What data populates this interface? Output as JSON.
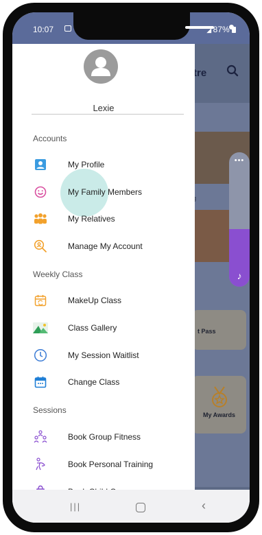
{
  "status_bar": {
    "time": "10:07",
    "battery": "87%"
  },
  "background": {
    "title": "tre",
    "tile_caption": "ng",
    "card_pass": "t Pass",
    "card_awards": "My Awards"
  },
  "drawer": {
    "profile_name": "Lexie",
    "sections": [
      {
        "title": "Accounts",
        "items": [
          {
            "label": "My Profile",
            "icon": "profile-card-icon"
          },
          {
            "label": "My Family Members",
            "icon": "smiley-icon"
          },
          {
            "label": "My Relatives",
            "icon": "group-icon"
          },
          {
            "label": "Manage My Account",
            "icon": "search-person-icon"
          }
        ]
      },
      {
        "title": "Weekly Class",
        "items": [
          {
            "label": "MakeUp Class",
            "icon": "calendar-refresh-icon"
          },
          {
            "label": "Class Gallery",
            "icon": "gallery-icon"
          },
          {
            "label": "My Session Waitlist",
            "icon": "clock-icon"
          },
          {
            "label": "Change Class",
            "icon": "calendar-icon"
          }
        ]
      },
      {
        "title": "Sessions",
        "items": [
          {
            "label": "Book Group Fitness",
            "icon": "group-fitness-icon"
          },
          {
            "label": "Book Personal Training",
            "icon": "personal-training-icon"
          },
          {
            "label": "Book Child Care",
            "icon": "child-care-icon"
          }
        ]
      }
    ]
  },
  "colors": {
    "blue_icon": "#3a9be0",
    "pink_icon": "#d94fa0",
    "orange_icon": "#f2a12c",
    "purple_icon": "#8a4fd0",
    "overlay": "#5d6a86"
  }
}
